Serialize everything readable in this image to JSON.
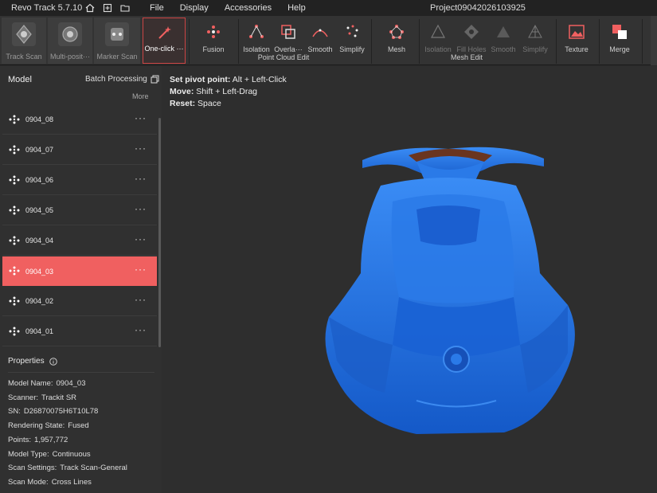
{
  "titlebar": {
    "app_name": "Revo Track 5.7.10",
    "menu": [
      "File",
      "Display",
      "Accessories",
      "Help"
    ],
    "project": "Project09042026103925"
  },
  "toolbar": {
    "scan_buttons": [
      {
        "label": "Track Scan",
        "icon": "track-scan-icon"
      },
      {
        "label": "Multi-posit···",
        "icon": "multi-position-icon"
      },
      {
        "label": "Marker Scan",
        "icon": "marker-scan-icon"
      }
    ],
    "one_click": "One-click ···",
    "point_cloud": {
      "group_label": "Point Cloud Edit",
      "buttons": [
        "Fusion",
        "Isolation",
        "Overla···",
        "Smooth",
        "Simplify"
      ]
    },
    "mesh": {
      "group_label": "Mesh Edit",
      "buttons": [
        "Mesh",
        "Isolation",
        "Fill Holes",
        "Smooth",
        "Simplify"
      ]
    },
    "texture": "Texture",
    "merge": "Merge"
  },
  "panel": {
    "title": "Model",
    "batch": "Batch Processing",
    "more": "More",
    "items": [
      {
        "name": "0904_08",
        "selected": false
      },
      {
        "name": "0904_07",
        "selected": false
      },
      {
        "name": "0904_06",
        "selected": false
      },
      {
        "name": "0904_05",
        "selected": false
      },
      {
        "name": "0904_04",
        "selected": false
      },
      {
        "name": "0904_03",
        "selected": true
      },
      {
        "name": "0904_02",
        "selected": false
      },
      {
        "name": "0904_01",
        "selected": false
      }
    ],
    "more_options": "···",
    "properties_title": "Properties",
    "properties": [
      {
        "key": "Model Name:",
        "value": "0904_03"
      },
      {
        "key": "Scanner:",
        "value": "Trackit SR"
      },
      {
        "key": "SN:",
        "value": "D26870075H6T10L78"
      },
      {
        "key": "Rendering State:",
        "value": "Fused"
      },
      {
        "key": "Points:",
        "value": "1,957,772"
      },
      {
        "key": "Model Type:",
        "value": "Continuous"
      },
      {
        "key": "Scan Settings:",
        "value": "Track Scan-General"
      },
      {
        "key": "Scan Mode:",
        "value": "Cross Lines"
      }
    ]
  },
  "viewport": {
    "hints": [
      {
        "key": "Set pivot point:",
        "value": "Alt + Left-Click"
      },
      {
        "key": "Move:",
        "value": "Shift + Left-Drag"
      },
      {
        "key": "Reset:",
        "value": "Space"
      }
    ]
  },
  "colors": {
    "accent": "#f06060",
    "model_blue": "#1f6fe0",
    "panel_bg": "#303030",
    "viewport_bg": "#2e2e2e"
  }
}
